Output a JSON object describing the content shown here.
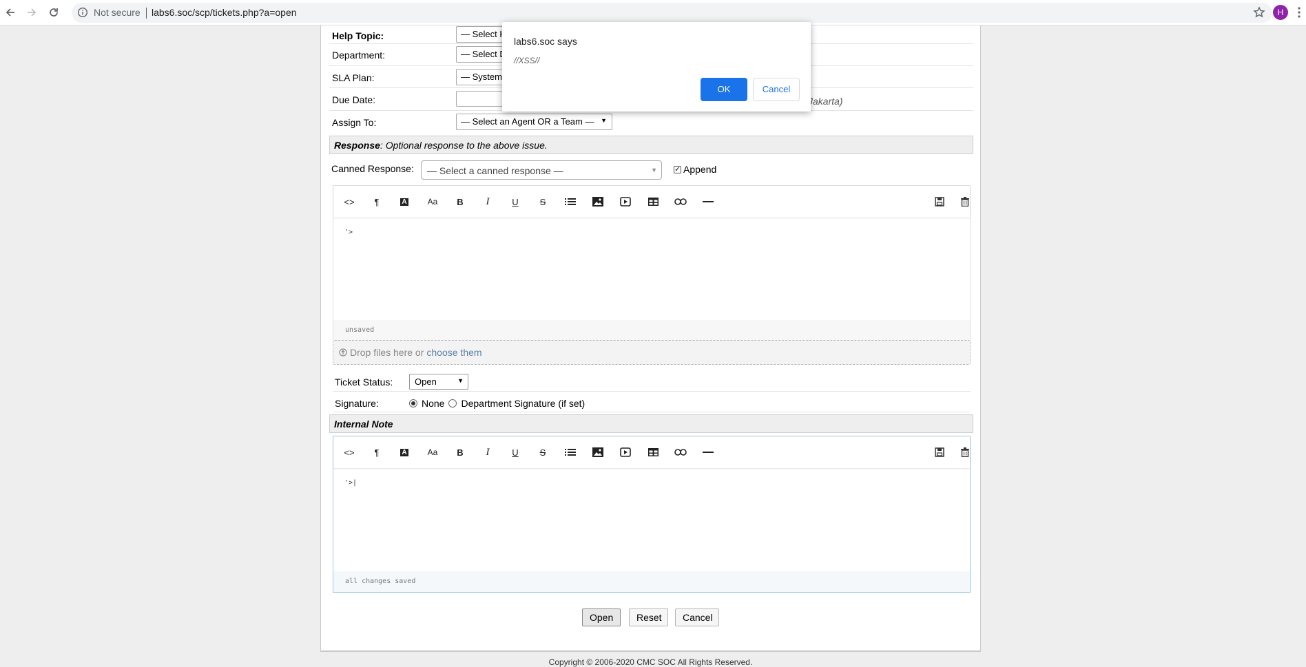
{
  "browser": {
    "security_label": "Not secure",
    "url": "labs6.soc/scp/tickets.php?a=open",
    "avatar_letter": "H"
  },
  "form": {
    "help_topic": {
      "label": "Help Topic:",
      "value": "— Select H"
    },
    "department": {
      "label": "Department:",
      "value": "— Select D"
    },
    "sla_plan": {
      "label": "SLA Plan:",
      "value": "— System"
    },
    "due_date": {
      "label": "Due Date:",
      "value": "",
      "timezone_hint": "Jakarta)"
    },
    "assign_to": {
      "label": "Assign To:",
      "value": "— Select an Agent OR a Team —"
    }
  },
  "response": {
    "header_bold": "Response",
    "header_text": ": Optional response to the above issue.",
    "canned_label": "Canned Response:",
    "canned_value": "— Select a canned response —",
    "append_label": "Append",
    "append_checked": true,
    "editor_text": "'>",
    "editor_status": "unsaved"
  },
  "dropzone": {
    "text": "Drop files here or",
    "link": "choose them"
  },
  "ticket_status": {
    "label": "Ticket Status:",
    "value": "Open"
  },
  "signature": {
    "label": "Signature:",
    "options": [
      "None",
      "Department Signature (if set)"
    ],
    "selected": "None"
  },
  "internal_note": {
    "header": "Internal Note",
    "editor_text": "'>|",
    "editor_status": "all changes saved"
  },
  "buttons": {
    "open": "Open",
    "reset": "Reset",
    "cancel": "Cancel"
  },
  "footer": {
    "text": "Copyright © 2006-2020 CMC SOC All Rights Reserved."
  },
  "dialog": {
    "title": "labs6.soc says",
    "message": "//XSS//",
    "ok": "OK",
    "cancel": "Cancel",
    "ok_color": "#1a73e8"
  },
  "toolbar_icons": [
    "code-icon",
    "paragraph-icon",
    "text-color-icon",
    "font-size-icon",
    "bold-icon",
    "italic-icon",
    "underline-icon",
    "strikethrough-icon",
    "list-icon",
    "image-icon",
    "video-icon",
    "table-icon",
    "link-icon",
    "horizontal-rule-icon",
    "save-draft-icon",
    "delete-draft-icon"
  ]
}
